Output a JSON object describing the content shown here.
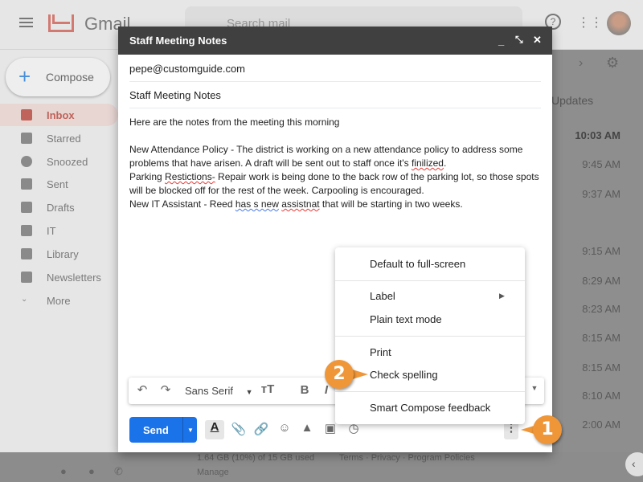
{
  "app": {
    "name": "Gmail",
    "search_placeholder": "Search mail"
  },
  "sidebar": {
    "compose": "Compose",
    "items": [
      {
        "label": "Inbox",
        "active": true
      },
      {
        "label": "Starred"
      },
      {
        "label": "Snoozed"
      },
      {
        "label": "Sent"
      },
      {
        "label": "Drafts"
      },
      {
        "label": "IT"
      },
      {
        "label": "Library"
      },
      {
        "label": "Newsletters"
      },
      {
        "label": "More"
      }
    ]
  },
  "inbox": {
    "tab": "Updates",
    "times": [
      "10:03 AM",
      "9:45 AM",
      "9:37 AM",
      "9:15 AM",
      "8:29 AM",
      "8:23 AM",
      "8:15 AM",
      "8:15 AM",
      "8:10 AM",
      "2:00 AM"
    ]
  },
  "footer": {
    "storage": "1.64 GB (10%) of 15 GB used",
    "manage": "Manage",
    "links": "Terms · Privacy · Program Policies"
  },
  "compose": {
    "title": "Staff Meeting Notes",
    "to": "pepe@customguide.com",
    "subject": "Staff Meeting Notes",
    "body": {
      "line1": "Here are the notes from the meeting this morning",
      "p1a": "New Attendance Policy - The district is working on a new attendance policy to address some problems that have arisen. A draft will be sent out to staff once it's ",
      "p1err": "finilized",
      "p2err": "Restictions-",
      "p2a": "Parking ",
      "p2b": " Repair work is being done to the back row of the parking lot, so those spots will be blocked off for the rest of the week. Carpooling is encouraged.",
      "p3a": "New IT Assistant - Reed ",
      "p3grammar": "has s new",
      "p3err": "assistnat",
      "p3b": " that will be starting in two weeks."
    },
    "font": "Sans Serif",
    "send": "Send"
  },
  "menu": {
    "items": [
      "Default to full-screen",
      "Label",
      "Plain text mode",
      "Print",
      "Check spelling",
      "Smart Compose feedback"
    ]
  },
  "callouts": [
    "1",
    "2"
  ],
  "colors": {
    "send": "#1a73e8",
    "callout": "#ef9638",
    "header": "#404040"
  }
}
